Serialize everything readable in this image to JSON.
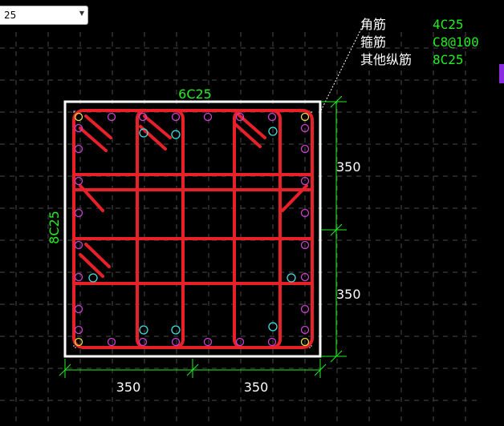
{
  "toolbar": {
    "combo_value": "25"
  },
  "legend": {
    "rows": [
      {
        "label": "角筋",
        "value": "4C25"
      },
      {
        "label": "箍筋",
        "value": "C8@100"
      },
      {
        "label": "其他纵筋",
        "value": "8C25"
      }
    ]
  },
  "section": {
    "top_bars": "6C25",
    "side_bars": "8C25",
    "dims_right": [
      "350",
      "350"
    ],
    "dims_bottom": [
      "350",
      "350"
    ]
  },
  "colors": {
    "background": "#000000",
    "section_outline": "#ffffff",
    "stirrup": "#e8202a",
    "text_green": "#22ee22",
    "dimension": "#22ee22",
    "bar_magenta": "#d040d0",
    "bar_corner": "#e8e040",
    "bar_cyan": "#40e0e0",
    "grid": "#4a4a4a"
  }
}
